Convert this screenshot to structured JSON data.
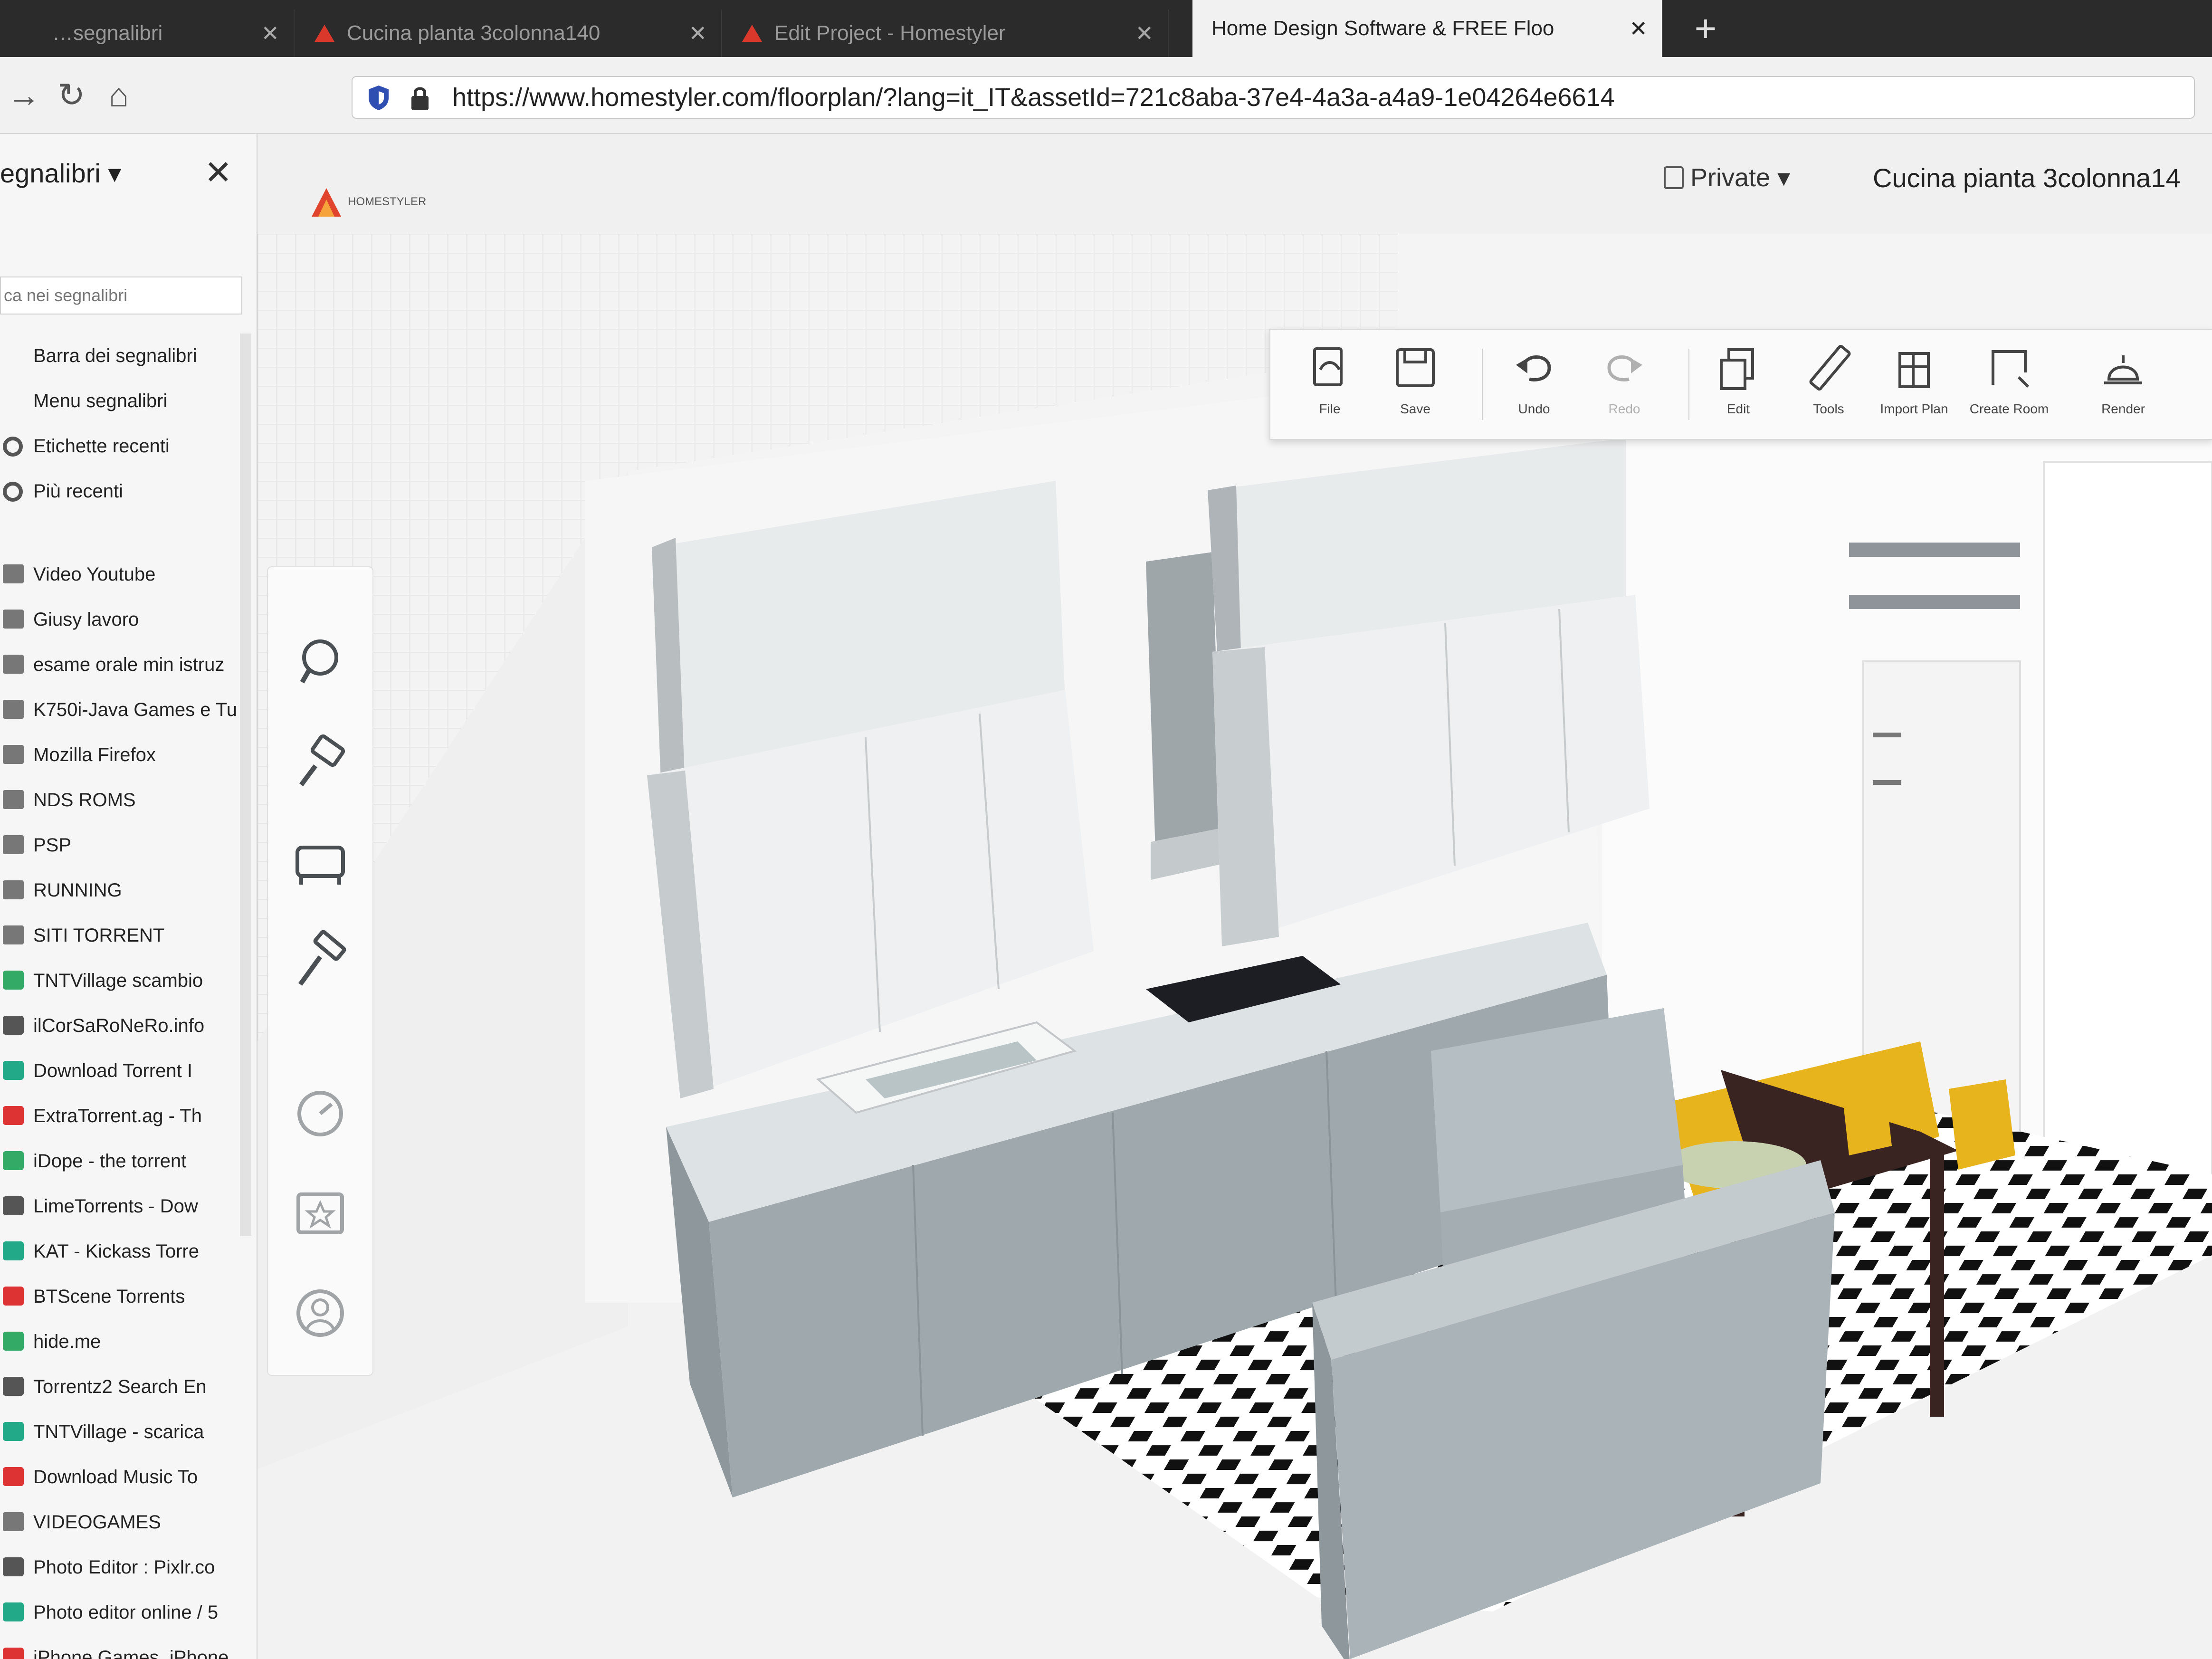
{
  "browser": {
    "tabs": [
      {
        "label": "…segnalibri",
        "active": false
      },
      {
        "label": "Cucina planta 3colonna140",
        "active": false
      },
      {
        "label": "Edit Project - Homestyler",
        "active": false
      },
      {
        "label": "Home Design Software & FREE Floo",
        "active": true
      }
    ],
    "tab_close_glyph": "✕",
    "new_tab_glyph": "+",
    "nav": {
      "back_glyph": "→",
      "reload_glyph": "↻",
      "home_glyph": "⌂"
    },
    "url": "https://www.homestyler.com/floorplan/?lang=it_IT&assetId=721c8aba-37e4-4a3a-a4a9-1e04264e6614"
  },
  "sidebar": {
    "title": "egnalibri ▾",
    "close_glyph": "✕",
    "search_placeholder": "ca nei segnalibri",
    "items": [
      {
        "label": "Barra dei segnalibri",
        "icon": "none"
      },
      {
        "label": "Menu segnalibri",
        "icon": "none"
      },
      {
        "label": "Etichette recenti",
        "icon": "gear-icon"
      },
      {
        "label": "Più recenti",
        "icon": "gear-icon"
      },
      {
        "label": "Video Youtube",
        "icon": "folder-icon"
      },
      {
        "label": "Giusy lavoro",
        "icon": "folder-icon"
      },
      {
        "label": "esame orale min istruz",
        "icon": "folder-icon"
      },
      {
        "label": "K750i-Java Games e Tu",
        "icon": "folder-icon"
      },
      {
        "label": "Mozilla Firefox",
        "icon": "folder-icon"
      },
      {
        "label": "NDS ROMS",
        "icon": "folder-icon"
      },
      {
        "label": "PSP",
        "icon": "folder-icon"
      },
      {
        "label": "RUNNING",
        "icon": "folder-icon"
      },
      {
        "label": "SITI TORRENT",
        "icon": "folder-icon"
      },
      {
        "label": "TNTVillage scambio",
        "icon": "site-icon"
      },
      {
        "label": "ilCorSaRoNeRo.info",
        "icon": "site-icon"
      },
      {
        "label": "Download Torrent I",
        "icon": "site-icon"
      },
      {
        "label": "ExtraTorrent.ag - Th",
        "icon": "site-icon"
      },
      {
        "label": "iDope - the torrent",
        "icon": "site-icon"
      },
      {
        "label": "LimeTorrents - Dow",
        "icon": "site-icon"
      },
      {
        "label": "KAT - Kickass Torre",
        "icon": "site-icon"
      },
      {
        "label": "BTScene Torrents",
        "icon": "site-icon"
      },
      {
        "label": "hide.me",
        "icon": "site-icon"
      },
      {
        "label": "Torrentz2 Search En",
        "icon": "site-icon"
      },
      {
        "label": "TNTVillage - scarica",
        "icon": "site-icon"
      },
      {
        "label": "Download Music To",
        "icon": "site-icon"
      },
      {
        "label": "VIDEOGAMES",
        "icon": "folder-icon"
      },
      {
        "label": "Photo Editor : Pixlr.co",
        "icon": "site-icon"
      },
      {
        "label": "Photo editor online / 5",
        "icon": "site-icon"
      },
      {
        "label": "iPhone Games, iPhone",
        "icon": "site-icon"
      }
    ]
  },
  "app": {
    "logo_text_1": "HOMESTYLER",
    "logo_text_2": "",
    "privacy_label": "Private ▾",
    "project_title": "Cucina pianta 3colonna14",
    "toolbar": [
      {
        "label": "File",
        "icon": "file-icon",
        "enabled": true
      },
      {
        "label": "Save",
        "icon": "save-icon",
        "enabled": true
      },
      {
        "label": "Undo",
        "icon": "undo-icon",
        "enabled": true
      },
      {
        "label": "Redo",
        "icon": "redo-icon",
        "enabled": false
      },
      {
        "label": "Edit",
        "icon": "edit-icon",
        "enabled": true
      },
      {
        "label": "Tools",
        "icon": "ruler-icon",
        "enabled": true
      },
      {
        "label": "Import Plan",
        "icon": "import-plan-icon",
        "enabled": true
      },
      {
        "label": "Create Room",
        "icon": "create-room-icon",
        "enabled": true
      },
      {
        "label": "Render",
        "icon": "render-icon",
        "enabled": true
      }
    ],
    "left_tools": [
      "search-icon",
      "paint-roller-icon",
      "sofa-icon",
      "hammer-icon",
      "compass-icon",
      "favorites-icon",
      "user-icon"
    ]
  },
  "colors": {
    "cabinet_top": "#e9eced",
    "cabinet_side": "#b7bcbf",
    "base_front": "#9ea8ad",
    "chair": "#e8b41e",
    "table": "#3a2422"
  }
}
